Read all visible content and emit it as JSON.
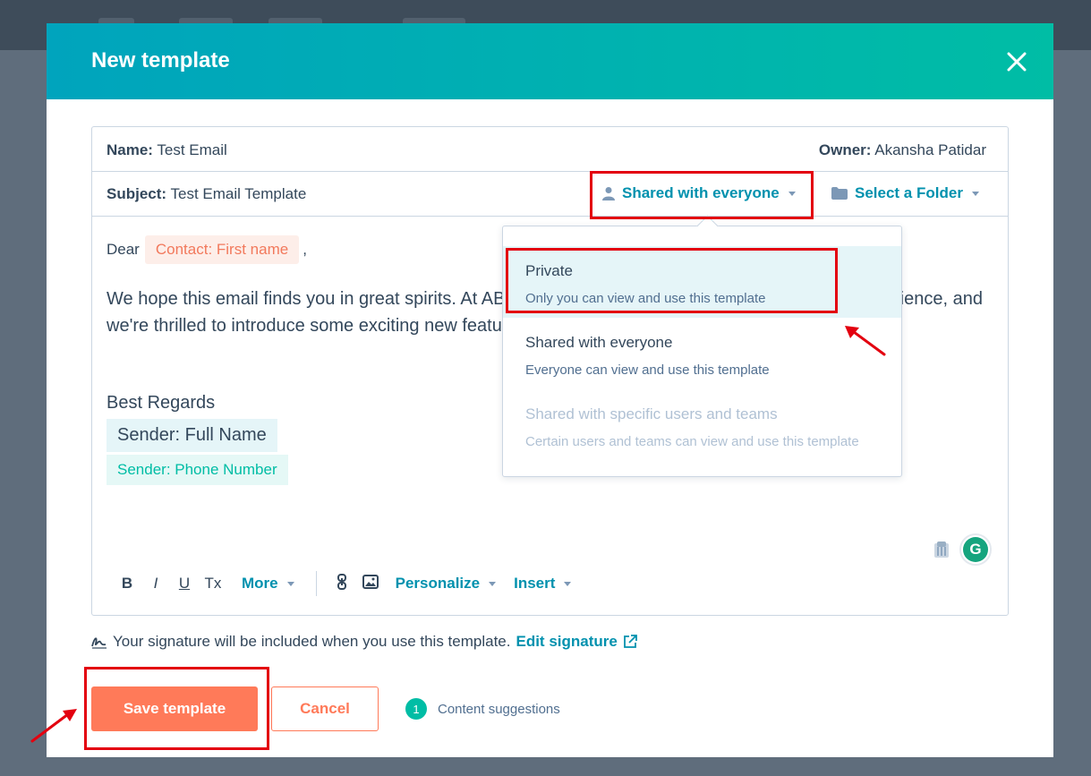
{
  "modal": {
    "title": "New template",
    "close_icon": "close-icon"
  },
  "fields": {
    "name_label": "Name:",
    "name_value": "Test Email",
    "owner_label": "Owner:",
    "owner_value": "Akansha Patidar",
    "subject_label": "Subject:",
    "subject_value": "Test Email Template",
    "sharing_label": "Shared with everyone",
    "folder_label": "Select a Folder"
  },
  "body": {
    "greeting": "Dear",
    "contact_token": "Contact: First name",
    "greeting_punct": ",",
    "paragraph_line1": "We hope this email finds you in great spirits. At AB",
    "paragraph_line1_end": "rience, and",
    "paragraph_line2": "we're thrilled to introduce some exciting new featu",
    "regards": "Best Regards",
    "sender_token": "Sender: Full Name",
    "phone_token": "Sender: Phone Number"
  },
  "toolbar": {
    "bold": "B",
    "italic": "I",
    "underline": "U",
    "clear_format": "Tx",
    "more": "More",
    "personalize": "Personalize",
    "insert": "Insert"
  },
  "sharing_dropdown": {
    "options": [
      {
        "title": "Private",
        "description": "Only you can view and use this template",
        "state": "highlighted"
      },
      {
        "title": "Shared with everyone",
        "description": "Everyone can view and use this template",
        "state": "normal"
      },
      {
        "title": "Shared with specific users and teams",
        "description": "Certain users and teams can view and use this template",
        "state": "disabled"
      }
    ]
  },
  "signature": {
    "note": "Your signature will be included when you use this template.",
    "edit_link": "Edit signature"
  },
  "footer": {
    "save": "Save template",
    "cancel": "Cancel",
    "suggestions_count": "1",
    "suggestions_label": "Content suggestions"
  },
  "colors": {
    "header_gradient_start": "#00a4bd",
    "header_gradient_end": "#00bda5",
    "primary_orange": "#ff7a59",
    "link_teal": "#0091ae",
    "annotation_red": "#e3000f"
  }
}
